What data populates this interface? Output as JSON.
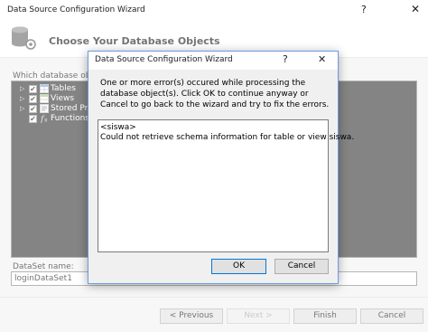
{
  "window": {
    "title": "Data Source Configuration Wizard",
    "help_glyph": "?",
    "close_glyph": "✕",
    "icon": "database-gear-icon"
  },
  "header": {
    "title": "Choose Your Database Objects"
  },
  "objects": {
    "label": "Which database objec",
    "items": [
      {
        "label": "Tables",
        "checked": true,
        "expander": "▷",
        "icon": "table-icon"
      },
      {
        "label": "Views",
        "checked": true,
        "expander": "▷",
        "icon": "view-icon"
      },
      {
        "label": "Stored Proc",
        "checked": true,
        "expander": "▷",
        "icon": "stored-procedure-icon"
      },
      {
        "label": "Functions",
        "checked": true,
        "expander": "",
        "icon": "function-icon"
      }
    ],
    "check_glyph": "✔",
    "tree_background": "#1f1f1f"
  },
  "dataset": {
    "label": "DataSet name:",
    "value": "loginDataSet1"
  },
  "buttons": {
    "previous": "< Previous",
    "next": "Next >",
    "finish": "Finish",
    "cancel": "Cancel"
  },
  "dialog": {
    "title": "Data Source Configuration Wizard",
    "help_glyph": "?",
    "close_glyph": "✕",
    "message": "One or more error(s) occured while processing the database object(s). Click OK to continue anyway or Cancel to go back to the wizard and try to fix the errors.",
    "details": [
      "<siswa>",
      "Could not retrieve schema information for table or view siswa."
    ],
    "ok": "OK",
    "cancel": "Cancel"
  },
  "colors": {
    "accent": "#0078d7",
    "dialog_border": "#6a9ce2",
    "panel": "#f0f0f0"
  }
}
